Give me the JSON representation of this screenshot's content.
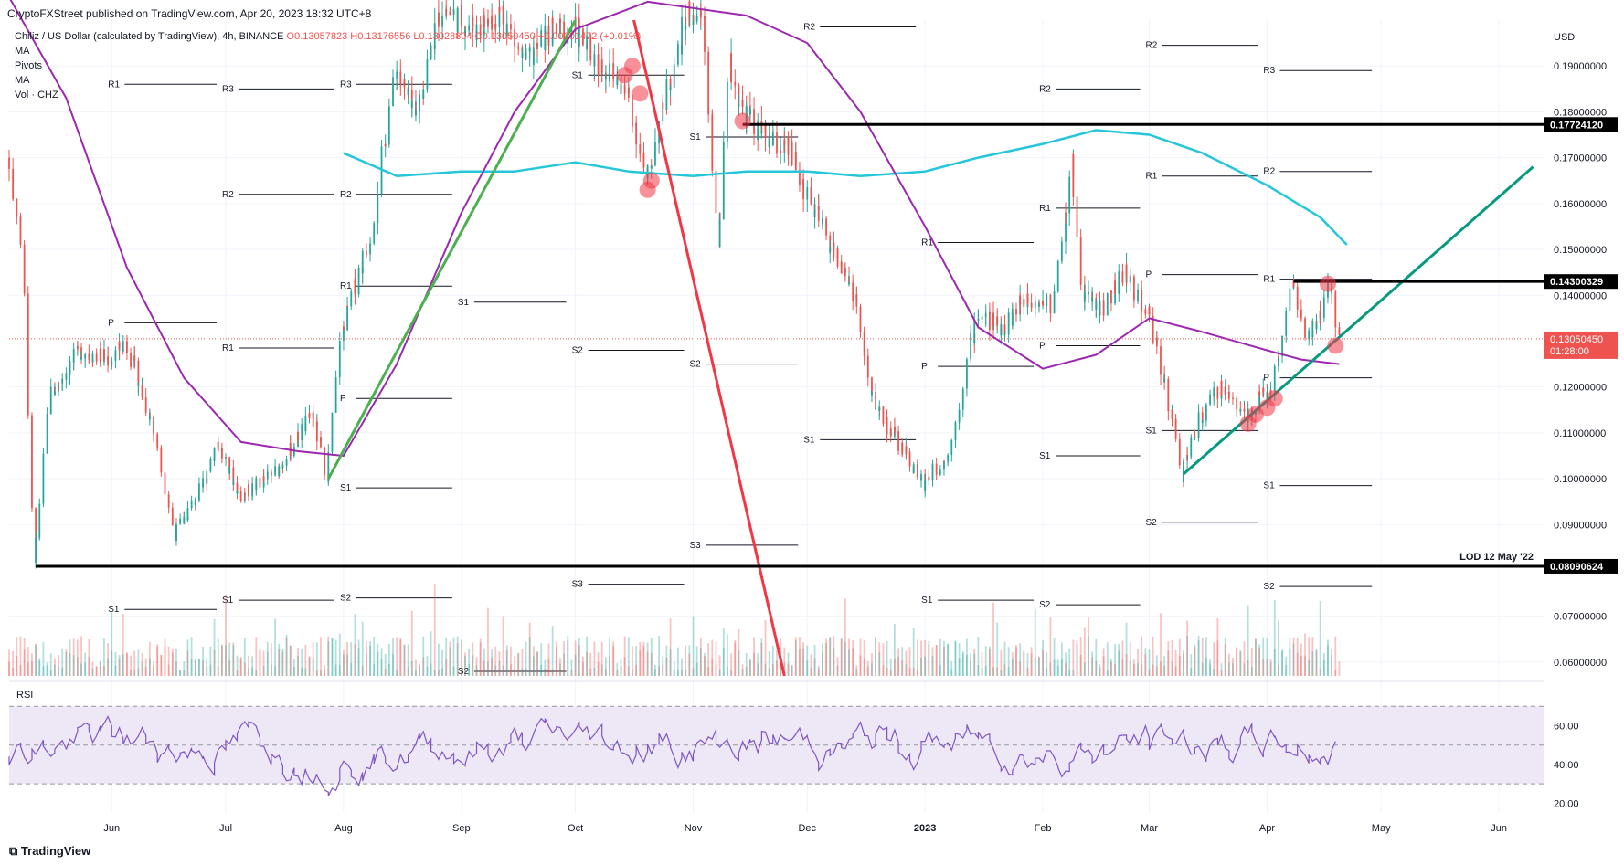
{
  "header": {
    "published_by": "CryptoFXStreet published on TradingView.com, Apr 20, 2023 18:32 UTC+8"
  },
  "legend": {
    "symbol": "Chiliz / US Dollar (calculated by TradingView), 4h, BINANCE",
    "ohlc": "O0.13057823 H0.13176556 L0.13028804 C0.13050450 +0.00001472 (+0.01%)",
    "indicators": [
      "MA",
      "Pivots",
      "MA",
      "Vol · CHZ"
    ]
  },
  "footer": {
    "brand": "TradingView"
  },
  "colors": {
    "up": "#26a69a",
    "down": "#ef5350",
    "ma_long": "#26c6da",
    "ma_short": "#9c27b0",
    "trend_green": "#4caf50",
    "trend_red": "#f23645",
    "trend_teal": "#089981",
    "rsi": "#7e57c2",
    "rsi_band": "#ede7f6"
  },
  "chart_data": {
    "type": "candlestick",
    "timeframe": "4h",
    "currency_label": "USD",
    "x_labels": [
      "Jun",
      "Jul",
      "Aug",
      "Sep",
      "Oct",
      "Nov",
      "Dec",
      "2023",
      "Feb",
      "Mar",
      "Apr",
      "May",
      "Jun"
    ],
    "x_label_dates": [
      "2022-06-01",
      "2022-07-01",
      "2022-08-01",
      "2022-09-01",
      "2022-10-01",
      "2022-11-01",
      "2022-12-01",
      "2023-01-01",
      "2023-02-01",
      "2023-03-01",
      "2023-04-01",
      "2023-05-01",
      "2023-06-01"
    ],
    "x_range": [
      "2022-05-05",
      "2023-06-13"
    ],
    "y_range": [
      0.057,
      0.2
    ],
    "y_ticks": [
      {
        "value": 0.19,
        "label": "0.19000000"
      },
      {
        "value": 0.18,
        "label": "0.18000000"
      },
      {
        "value": 0.17,
        "label": "0.17000000"
      },
      {
        "value": 0.16,
        "label": "0.16000000"
      },
      {
        "value": 0.15,
        "label": "0.15000000"
      },
      {
        "value": 0.14,
        "label": "0.14000000"
      },
      {
        "value": 0.12,
        "label": "0.12000000"
      },
      {
        "value": 0.11,
        "label": "0.11000000"
      },
      {
        "value": 0.1,
        "label": "0.10000000"
      },
      {
        "value": 0.09,
        "label": "0.09000000"
      },
      {
        "value": 0.07,
        "label": "0.07000000"
      },
      {
        "value": 0.06,
        "label": "0.06000000"
      }
    ],
    "price_path": [
      [
        "2022-05-05",
        0.17
      ],
      [
        "2022-05-09",
        0.15
      ],
      [
        "2022-05-12",
        0.081
      ],
      [
        "2022-05-16",
        0.118
      ],
      [
        "2022-05-24",
        0.128
      ],
      [
        "2022-06-01",
        0.126
      ],
      [
        "2022-06-05",
        0.13
      ],
      [
        "2022-06-12",
        0.112
      ],
      [
        "2022-06-18",
        0.088
      ],
      [
        "2022-06-25",
        0.098
      ],
      [
        "2022-06-29",
        0.108
      ],
      [
        "2022-07-05",
        0.096
      ],
      [
        "2022-07-15",
        0.102
      ],
      [
        "2022-07-24",
        0.114
      ],
      [
        "2022-07-28",
        0.101
      ],
      [
        "2022-08-01",
        0.133
      ],
      [
        "2022-08-09",
        0.155
      ],
      [
        "2022-08-15",
        0.19
      ],
      [
        "2022-08-20",
        0.178
      ],
      [
        "2022-08-27",
        0.203
      ],
      [
        "2022-09-05",
        0.198
      ],
      [
        "2022-09-12",
        0.202
      ],
      [
        "2022-09-18",
        0.19
      ],
      [
        "2022-09-24",
        0.197
      ],
      [
        "2022-10-01",
        0.198
      ],
      [
        "2022-10-06",
        0.192
      ],
      [
        "2022-10-12",
        0.187
      ],
      [
        "2022-10-16",
        0.182
      ],
      [
        "2022-10-20",
        0.164
      ],
      [
        "2022-10-25",
        0.183
      ],
      [
        "2022-10-31",
        0.202
      ],
      [
        "2022-11-04",
        0.2
      ],
      [
        "2022-11-08",
        0.152
      ],
      [
        "2022-11-11",
        0.19
      ],
      [
        "2022-11-14",
        0.181
      ],
      [
        "2022-11-20",
        0.174
      ],
      [
        "2022-11-27",
        0.171
      ],
      [
        "2022-12-01",
        0.162
      ],
      [
        "2022-12-08",
        0.15
      ],
      [
        "2022-12-14",
        0.14
      ],
      [
        "2022-12-18",
        0.118
      ],
      [
        "2022-12-25",
        0.108
      ],
      [
        "2023-01-01",
        0.099
      ],
      [
        "2023-01-08",
        0.106
      ],
      [
        "2023-01-15",
        0.136
      ],
      [
        "2023-01-22",
        0.133
      ],
      [
        "2023-01-28",
        0.14
      ],
      [
        "2023-02-04",
        0.138
      ],
      [
        "2023-02-09",
        0.168
      ],
      [
        "2023-02-12",
        0.14
      ],
      [
        "2023-02-17",
        0.137
      ],
      [
        "2023-02-23",
        0.145
      ],
      [
        "2023-03-01",
        0.136
      ],
      [
        "2023-03-05",
        0.123
      ],
      [
        "2023-03-10",
        0.101
      ],
      [
        "2023-03-14",
        0.112
      ],
      [
        "2023-03-20",
        0.12
      ],
      [
        "2023-03-27",
        0.114
      ],
      [
        "2023-04-03",
        0.121
      ],
      [
        "2023-04-08",
        0.143
      ],
      [
        "2023-04-12",
        0.129
      ],
      [
        "2023-04-18",
        0.142
      ],
      [
        "2023-04-20",
        0.1305
      ]
    ],
    "ma_long": [
      [
        "2022-08-01",
        0.171
      ],
      [
        "2022-08-15",
        0.166
      ],
      [
        "2022-09-01",
        0.167
      ],
      [
        "2022-09-15",
        0.167
      ],
      [
        "2022-10-01",
        0.169
      ],
      [
        "2022-10-15",
        0.167
      ],
      [
        "2022-11-01",
        0.166
      ],
      [
        "2022-11-15",
        0.167
      ],
      [
        "2022-12-01",
        0.167
      ],
      [
        "2022-12-15",
        0.166
      ],
      [
        "2023-01-01",
        0.167
      ],
      [
        "2023-01-15",
        0.17
      ],
      [
        "2023-02-01",
        0.173
      ],
      [
        "2023-02-15",
        0.176
      ],
      [
        "2023-03-01",
        0.175
      ],
      [
        "2023-03-15",
        0.171
      ],
      [
        "2023-04-01",
        0.164
      ],
      [
        "2023-04-15",
        0.157
      ],
      [
        "2023-04-22",
        0.151
      ]
    ],
    "ma_short": [
      [
        "2022-05-05",
        0.205
      ],
      [
        "2022-05-20",
        0.183
      ],
      [
        "2022-06-05",
        0.146
      ],
      [
        "2022-06-20",
        0.122
      ],
      [
        "2022-07-05",
        0.108
      ],
      [
        "2022-07-20",
        0.106
      ],
      [
        "2022-08-01",
        0.105
      ],
      [
        "2022-08-15",
        0.125
      ],
      [
        "2022-09-01",
        0.158
      ],
      [
        "2022-09-15",
        0.18
      ],
      [
        "2022-10-01",
        0.198
      ],
      [
        "2022-10-20",
        0.204
      ],
      [
        "2022-11-15",
        0.201
      ],
      [
        "2022-12-01",
        0.195
      ],
      [
        "2022-12-15",
        0.18
      ],
      [
        "2023-01-01",
        0.155
      ],
      [
        "2023-01-15",
        0.133
      ],
      [
        "2023-02-01",
        0.124
      ],
      [
        "2023-02-15",
        0.127
      ],
      [
        "2023-03-01",
        0.135
      ],
      [
        "2023-03-15",
        0.132
      ],
      [
        "2023-04-01",
        0.128
      ],
      [
        "2023-04-10",
        0.126
      ],
      [
        "2023-04-20",
        0.125
      ]
    ],
    "horizontal_levels": [
      {
        "value": 0.1772412,
        "label": "0.17724120",
        "from": "2022-11-14",
        "to": "2023-06-13"
      },
      {
        "value": 0.14300329,
        "label": "0.14300329",
        "from": "2023-04-08",
        "to": "2023-06-13"
      },
      {
        "value": 0.08090624,
        "label": "0.08090624",
        "from": "2022-05-12",
        "to": "2023-06-13",
        "annotation": "LOD 12 May '22"
      }
    ],
    "current_price": {
      "value": 0.1305045,
      "label": "0.13050450",
      "countdown": "01:28:00"
    },
    "trendlines": [
      {
        "color_key": "trend_green",
        "from": [
          "2022-07-28",
          0.1
        ],
        "to": [
          "2022-10-01",
          0.2
        ]
      },
      {
        "color_key": "trend_red",
        "from": [
          "2022-10-15",
          0.205
        ],
        "to": [
          "2022-11-25",
          0.057
        ]
      },
      {
        "color_key": "trend_teal",
        "from": [
          "2023-03-10",
          0.101
        ],
        "to": [
          "2023-06-10",
          0.168
        ]
      }
    ],
    "pivot_levels": [
      {
        "label": "R1",
        "value": 0.186,
        "from": "2022-06-01",
        "to": "2022-07-01"
      },
      {
        "label": "R3",
        "value": 0.185,
        "from": "2022-07-01",
        "to": "2022-08-01"
      },
      {
        "label": "R3",
        "value": 0.186,
        "from": "2022-08-01",
        "to": "2022-09-01"
      },
      {
        "label": "R2",
        "value": 0.162,
        "from": "2022-07-01",
        "to": "2022-08-01"
      },
      {
        "label": "R2",
        "value": 0.162,
        "from": "2022-08-01",
        "to": "2022-09-01"
      },
      {
        "label": "P",
        "value": 0.134,
        "from": "2022-06-01",
        "to": "2022-07-01"
      },
      {
        "label": "R1",
        "value": 0.1285,
        "from": "2022-07-01",
        "to": "2022-08-01"
      },
      {
        "label": "R1",
        "value": 0.142,
        "from": "2022-08-01",
        "to": "2022-09-01"
      },
      {
        "label": "S1",
        "value": 0.1385,
        "from": "2022-09-01",
        "to": "2022-10-01"
      },
      {
        "label": "S2",
        "value": 0.128,
        "from": "2022-10-01",
        "to": "2022-11-01"
      },
      {
        "label": "S1",
        "value": 0.188,
        "from": "2022-10-01",
        "to": "2022-11-01"
      },
      {
        "label": "S1",
        "value": 0.1745,
        "from": "2022-11-01",
        "to": "2022-12-01"
      },
      {
        "label": "S2",
        "value": 0.125,
        "from": "2022-11-01",
        "to": "2022-12-01"
      },
      {
        "label": "S3",
        "value": 0.0855,
        "from": "2022-11-01",
        "to": "2022-12-01"
      },
      {
        "label": "S3",
        "value": 0.077,
        "from": "2022-10-01",
        "to": "2022-11-01"
      },
      {
        "label": "P",
        "value": 0.1175,
        "from": "2022-08-01",
        "to": "2022-09-01"
      },
      {
        "label": "S1",
        "value": 0.098,
        "from": "2022-08-01",
        "to": "2022-09-01"
      },
      {
        "label": "S2",
        "value": 0.074,
        "from": "2022-08-01",
        "to": "2022-09-01"
      },
      {
        "label": "S2",
        "value": 0.058,
        "from": "2022-09-01",
        "to": "2022-10-01"
      },
      {
        "label": "S1",
        "value": 0.0735,
        "from": "2022-07-01",
        "to": "2022-08-01"
      },
      {
        "label": "S1",
        "value": 0.0715,
        "from": "2022-06-01",
        "to": "2022-07-01"
      },
      {
        "label": "P",
        "value": 0.1245,
        "from": "2023-01-01",
        "to": "2023-02-01"
      },
      {
        "label": "S1",
        "value": 0.1085,
        "from": "2022-12-01",
        "to": "2023-01-01"
      },
      {
        "label": "R1",
        "value": 0.1515,
        "from": "2023-01-01",
        "to": "2023-02-01"
      },
      {
        "label": "R2",
        "value": 0.1985,
        "from": "2022-12-01",
        "to": "2023-01-01"
      },
      {
        "label": "S1",
        "value": 0.0735,
        "from": "2023-01-01",
        "to": "2023-02-01"
      },
      {
        "label": "R2",
        "value": 0.185,
        "from": "2023-02-01",
        "to": "2023-03-01"
      },
      {
        "label": "R1",
        "value": 0.159,
        "from": "2023-02-01",
        "to": "2023-03-01"
      },
      {
        "label": "P",
        "value": 0.129,
        "from": "2023-02-01",
        "to": "2023-03-01"
      },
      {
        "label": "S1",
        "value": 0.105,
        "from": "2023-02-01",
        "to": "2023-03-01"
      },
      {
        "label": "S2",
        "value": 0.0725,
        "from": "2023-02-01",
        "to": "2023-03-01"
      },
      {
        "label": "R2",
        "value": 0.1945,
        "from": "2023-03-01",
        "to": "2023-04-01"
      },
      {
        "label": "R1",
        "value": 0.166,
        "from": "2023-03-01",
        "to": "2023-04-01"
      },
      {
        "label": "P",
        "value": 0.1445,
        "from": "2023-03-01",
        "to": "2023-04-01"
      },
      {
        "label": "S1",
        "value": 0.1105,
        "from": "2023-03-01",
        "to": "2023-04-01"
      },
      {
        "label": "S2",
        "value": 0.0905,
        "from": "2023-03-01",
        "to": "2023-04-01"
      },
      {
        "label": "R3",
        "value": 0.189,
        "from": "2023-04-01",
        "to": "2023-05-01"
      },
      {
        "label": "R2",
        "value": 0.167,
        "from": "2023-04-01",
        "to": "2023-05-01"
      },
      {
        "label": "R1",
        "value": 0.1435,
        "from": "2023-04-01",
        "to": "2023-05-01"
      },
      {
        "label": "P",
        "value": 0.122,
        "from": "2023-04-01",
        "to": "2023-05-01"
      },
      {
        "label": "S1",
        "value": 0.0985,
        "from": "2023-04-01",
        "to": "2023-05-01"
      },
      {
        "label": "S2",
        "value": 0.0765,
        "from": "2023-04-01",
        "to": "2023-05-01"
      }
    ],
    "highlight_points": [
      [
        "2022-10-16",
        0.19
      ],
      [
        "2022-10-14",
        0.188
      ],
      [
        "2022-10-18",
        0.184
      ],
      [
        "2022-10-21",
        0.165
      ],
      [
        "2022-10-20",
        0.163
      ],
      [
        "2022-11-14",
        0.178
      ],
      [
        "2023-03-27",
        0.112
      ],
      [
        "2023-03-29",
        0.114
      ],
      [
        "2023-04-01",
        0.1155
      ],
      [
        "2023-04-03",
        0.1175
      ],
      [
        "2023-04-17",
        0.1425
      ],
      [
        "2023-04-19",
        0.129
      ]
    ],
    "rsi": {
      "label": "RSI",
      "range": [
        15,
        80
      ],
      "band": [
        30,
        70
      ],
      "mid": 50,
      "ticks": [
        {
          "value": 60,
          "label": "60.00"
        },
        {
          "value": 40,
          "label": "40.00"
        },
        {
          "value": 20,
          "label": "20.00"
        }
      ]
    }
  }
}
